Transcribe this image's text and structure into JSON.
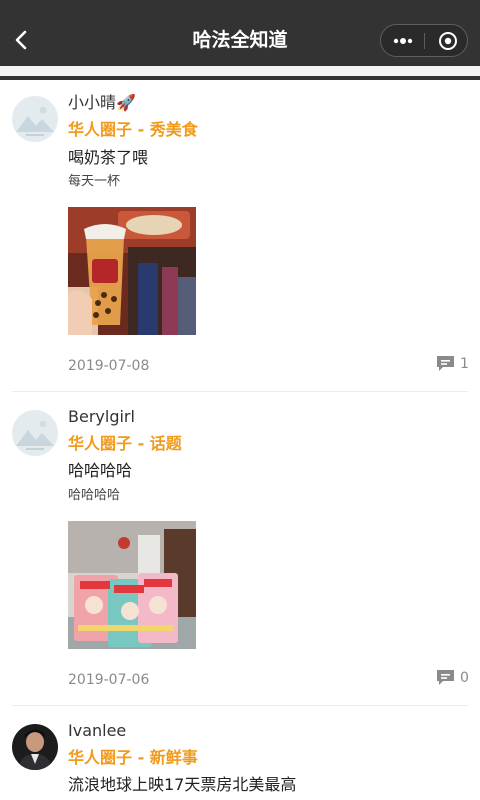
{
  "nav": {
    "title": "哈法全知道",
    "back_icon": "chevron-left-icon",
    "more_icon": "more-dots-icon",
    "close_icon": "target-close-icon",
    "bg_color": "#333333"
  },
  "accent_color": "#f19a1b",
  "posts": [
    {
      "author": "小小晴🚀",
      "circle": "华人圈子 - 秀美食",
      "title": "喝奶茶了喂",
      "subtitle": "每天一杯",
      "photo": "bubble-tea-photo",
      "date": "2019-07-08",
      "comment_count": "1",
      "avatar": "placeholder-mountain-avatar"
    },
    {
      "author": "Berylgirl",
      "circle": "华人圈子 - 话题",
      "title": "哈哈哈哈",
      "subtitle": "哈哈哈哈",
      "photo": "candy-packs-photo",
      "date": "2019-07-06",
      "comment_count": "0",
      "avatar": "placeholder-mountain-avatar"
    },
    {
      "author": "Ivanlee",
      "circle": "华人圈子 - 新鲜事",
      "title": "流浪地球上映17天票房北美最高",
      "avatar": "user-photo-avatar"
    }
  ]
}
